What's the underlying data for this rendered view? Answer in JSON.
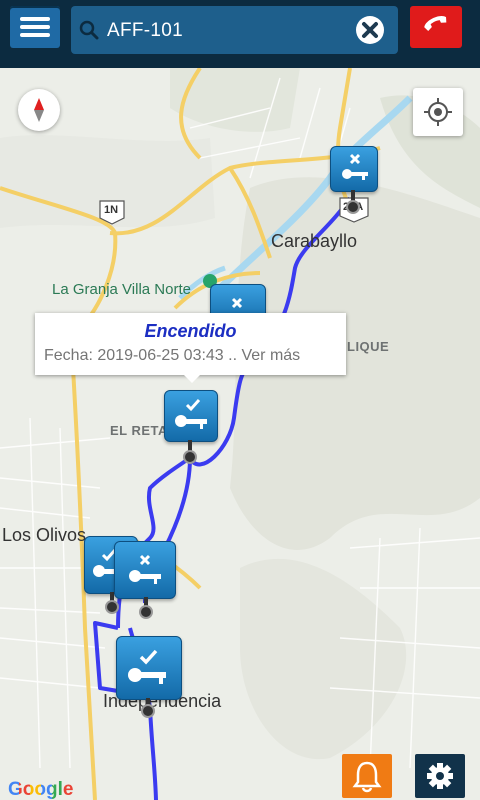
{
  "header": {
    "menu_icon": "hamburger-menu-icon",
    "search_query": "AFF-101",
    "search_icon": "search-icon",
    "clear_icon": "close-icon",
    "call_icon": "phone-icon"
  },
  "map": {
    "labels": {
      "city_carabayllo": "Carabayllo",
      "park": "La Granja Villa Norte",
      "district_retablo": "EL RETAB",
      "district_olivos": "Los Olivos",
      "district_independencia": "Independencia",
      "area_lique": "LIQUE",
      "route_1n": "1N",
      "route_20a": "20A"
    },
    "popup": {
      "title": "Encendido",
      "date_label": "Fecha:",
      "date_value": "2019-06-25 03:43",
      "more": ".. Ver más"
    },
    "attribution": "Google",
    "route_color": "#3b3bf0"
  },
  "markers": [
    {
      "status": "engine-off"
    },
    {
      "status": "engine-off"
    },
    {
      "status": "engine-on"
    },
    {
      "status": "engine-on"
    },
    {
      "status": "engine-off"
    },
    {
      "status": "engine-on"
    }
  ],
  "controls": {
    "compass_icon": "compass-icon",
    "locate_icon": "my-location-icon",
    "bell_icon": "bell-icon",
    "settings_icon": "gear-icon"
  },
  "colors": {
    "header_bg": "#0c2b40",
    "search_bg": "#1e5f8c",
    "call_button": "#e01b1b",
    "alerts_button": "#f07b14",
    "settings_button": "#11324a",
    "popup_title": "#1c2ec2"
  }
}
